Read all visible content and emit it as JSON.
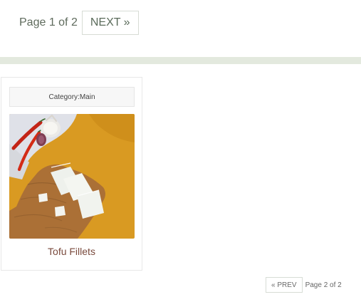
{
  "pagination_top": {
    "page_text": "Page 1 of 2",
    "next_label": "NEXT »"
  },
  "recipe_card": {
    "category_label": "Category:",
    "category_value": "Main",
    "image_icon": "tofu-photo-icon",
    "title": "Tofu Fillets"
  },
  "pagination_bottom": {
    "prev_label": "« PREV",
    "page_text": "Page 2 of 2"
  },
  "colors": {
    "divider": "#e3e9de",
    "title_link": "#7a4a3d",
    "text_muted": "#5f6b5d"
  }
}
